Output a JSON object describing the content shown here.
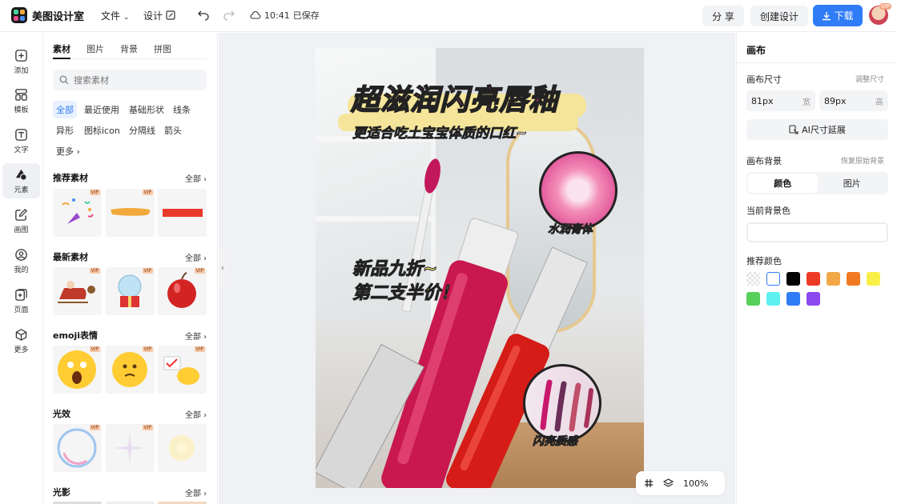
{
  "app": {
    "name": "美图设计室"
  },
  "topbar": {
    "file_menu": "文件",
    "design_menu": "设计",
    "save_time": "10:41",
    "save_status": "已保存",
    "share_label": "分 享",
    "create_label": "创建设计",
    "download_label": "下载",
    "avatar_badge": "VIP"
  },
  "rail": {
    "items": [
      {
        "label": "添加",
        "icon": "plus-square-icon"
      },
      {
        "label": "模板",
        "icon": "template-grid-icon"
      },
      {
        "label": "文字",
        "icon": "text-icon"
      },
      {
        "label": "元素",
        "icon": "shapes-icon",
        "active": true
      },
      {
        "label": "画图",
        "icon": "draw-edit-icon"
      },
      {
        "label": "我的",
        "icon": "user-icon"
      },
      {
        "label": "页面",
        "icon": "add-page-icon"
      },
      {
        "label": "更多",
        "icon": "cube-icon"
      }
    ]
  },
  "assets": {
    "tabs": [
      "素材",
      "图片",
      "背景",
      "拼图"
    ],
    "active_tab": "素材",
    "search_placeholder": "搜索素材",
    "chips": [
      "全部",
      "最近使用",
      "基础形状",
      "线条",
      "异形",
      "图标icon",
      "分隔线",
      "箭头",
      "更多"
    ],
    "sections": [
      {
        "title": "推荐素材",
        "all": "全部"
      },
      {
        "title": "最新素材",
        "all": "全部"
      },
      {
        "title": "emoji表情",
        "all": "全部"
      },
      {
        "title": "光效",
        "all": "全部"
      },
      {
        "title": "光影",
        "all": "全部"
      }
    ],
    "vip": "VIP"
  },
  "poster": {
    "title": "超滋润闪亮唇釉",
    "subtitle": "更适合吃土宝宝体质的口红~",
    "promo_1": "新品九折~",
    "promo_2": "第二支半价！",
    "badge_1": "水润膏体",
    "badge_2": "闪亮质感"
  },
  "zoom": {
    "level": "100%"
  },
  "canvas_panel": {
    "title": "画布",
    "size_label": "画布尺寸",
    "size_hint": "调整尺寸",
    "width_value": "81px",
    "width_unit": "宽",
    "height_value": "89px",
    "height_unit": "高",
    "ai_extend_label": "AI尺寸延展",
    "bg_label": "画布背景",
    "bg_hint": "恢复原始背景",
    "seg_color": "颜色",
    "seg_image": "图片",
    "current_bg_label": "当前背景色",
    "recommended_label": "推荐颜色",
    "colors": [
      "transparent",
      "#ffffff",
      "#000000",
      "#ec3a24",
      "#f3a848",
      "#f07a22",
      "#f8f048",
      "#57d05a",
      "#5ef0f0",
      "#2f7cf6",
      "#8a4af0"
    ]
  },
  "theme": {
    "accent": "#2f7cf6",
    "title_pink": "#f24aa0",
    "highlight_yellow": "#f5e59a"
  }
}
